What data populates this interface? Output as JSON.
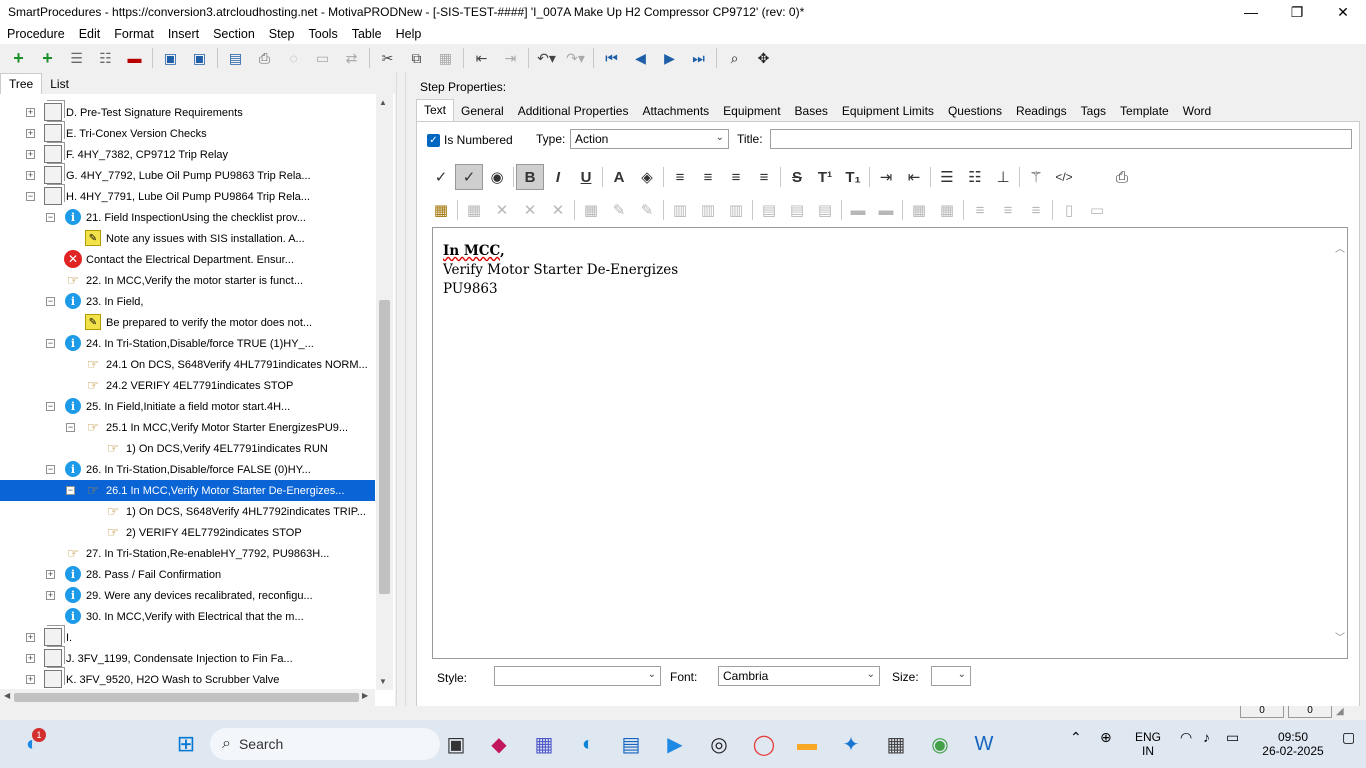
{
  "window": {
    "title": "SmartProcedures - https://conversion3.atrcloudhosting.net - MotivaPRODNew - [-SIS-TEST-####] 'I_007A Make Up H2 Compressor CP9712' (rev: 0)*",
    "minimize": "—",
    "maximize": "❐",
    "close": "✕"
  },
  "menu": [
    "Procedure",
    "Edit",
    "Format",
    "Insert",
    "Section",
    "Step",
    "Tools",
    "Table",
    "Help"
  ],
  "left_tabs": [
    "Tree",
    "List"
  ],
  "tree": [
    {
      "label": "D. Pre-Test Signature Requirements",
      "icon": "document-icon",
      "exp": "+"
    },
    {
      "label": "E. Tri-Conex Version Checks",
      "icon": "document-icon",
      "exp": "+"
    },
    {
      "label": "F. 4HY_7382, CP9712 Trip Relay",
      "icon": "document-icon",
      "exp": "+"
    },
    {
      "label": "G. 4HY_7792, Lube Oil Pump PU9863 Trip Rela...",
      "icon": "document-icon",
      "exp": "+"
    },
    {
      "label": "H. 4HY_7791, Lube Oil Pump PU9864 Trip Rela...",
      "icon": "document-icon",
      "exp": "−"
    },
    {
      "label": "21. Field InspectionUsing the checklist prov...",
      "icon": "info-icon",
      "exp": "−"
    },
    {
      "label": "Note any issues with SIS installation. A...",
      "icon": "note-icon",
      "exp": ""
    },
    {
      "label": "Contact the Electrical Department. Ensur...",
      "icon": "error-icon",
      "exp": ""
    },
    {
      "label": "22. In MCC,Verify the motor starter is funct...",
      "icon": "hand-icon",
      "exp": ""
    },
    {
      "label": "23. In Field,",
      "icon": "info-icon",
      "exp": "−"
    },
    {
      "label": "Be prepared to verify the motor does not...",
      "icon": "note-icon",
      "exp": ""
    },
    {
      "label": "24. In Tri-Station,Disable/force TRUE (1)HY_...",
      "icon": "info-icon",
      "exp": "−"
    },
    {
      "label": "24.1 On DCS, S648Verify 4HL7791indicates NORM...",
      "icon": "hand-icon",
      "exp": ""
    },
    {
      "label": "24.2 VERIFY 4EL7791indicates STOP",
      "icon": "hand-icon",
      "exp": ""
    },
    {
      "label": "25. In Field,Initiate a field motor start.4H...",
      "icon": "info-icon",
      "exp": "−"
    },
    {
      "label": "25.1 In MCC,Verify Motor Starter EnergizesPU9...",
      "icon": "hand-icon",
      "exp": "−"
    },
    {
      "label": "1) On DCS,Verify 4EL7791indicates RUN",
      "icon": "hand-icon",
      "exp": ""
    },
    {
      "label": "26. In Tri-Station,Disable/force FALSE (0)HY...",
      "icon": "info-icon",
      "exp": "−"
    },
    {
      "label": "26.1 In MCC,Verify Motor Starter De-Energizes...",
      "icon": "hand-icon",
      "exp": "−",
      "selected": true
    },
    {
      "label": "1) On DCS, S648Verify 4HL7792indicates TRIP...",
      "icon": "hand-icon",
      "exp": ""
    },
    {
      "label": "2) VERIFY 4EL7792indicates STOP",
      "icon": "hand-icon",
      "exp": ""
    },
    {
      "label": "27. In Tri-Station,Re-enableHY_7792, PU9863H...",
      "icon": "hand-icon",
      "exp": ""
    },
    {
      "label": "28. Pass / Fail Confirmation",
      "icon": "info-icon",
      "exp": "+"
    },
    {
      "label": "29. Were any devices recalibrated, reconfigu...",
      "icon": "info-icon",
      "exp": "+"
    },
    {
      "label": "30. In MCC,Verify with Electrical that the m...",
      "icon": "info-icon",
      "exp": ""
    },
    {
      "label": "I.",
      "icon": "document-icon",
      "exp": "+"
    },
    {
      "label": "J. 3FV_1199, Condensate Injection to Fin Fa...",
      "icon": "document-icon",
      "exp": "+"
    },
    {
      "label": "K. 3FV_9520, H2O Wash to Scrubber Valve",
      "icon": "document-icon",
      "exp": "+"
    }
  ],
  "step_properties": {
    "heading": "Step Properties:",
    "tabs": [
      "Text",
      "General",
      "Additional Properties",
      "Attachments",
      "Equipment",
      "Bases",
      "Equipment Limits",
      "Questions",
      "Readings",
      "Tags",
      "Template",
      "Word"
    ],
    "is_numbered_label": "Is Numbered",
    "type_label": "Type:",
    "type_value": "Action",
    "title_label": "Title:",
    "title_value": ""
  },
  "editor": {
    "line1_bold": "In MCC",
    "line1_rest": ",",
    "line2": "Verify Motor Starter De-Energizes",
    "line3": "PU9863"
  },
  "bottom": {
    "style_label": "Style:",
    "style_value": "",
    "font_label": "Font:",
    "font_value": "Cambria",
    "size_label": "Size:",
    "size_value": ""
  },
  "status": {
    "cell1": "0",
    "cell2": "0"
  },
  "taskbar": {
    "search_label": "Search",
    "lang_top": "ENG",
    "lang_bottom": "IN",
    "time": "09:50",
    "date": "26-02-2025",
    "notification_count": "1"
  }
}
